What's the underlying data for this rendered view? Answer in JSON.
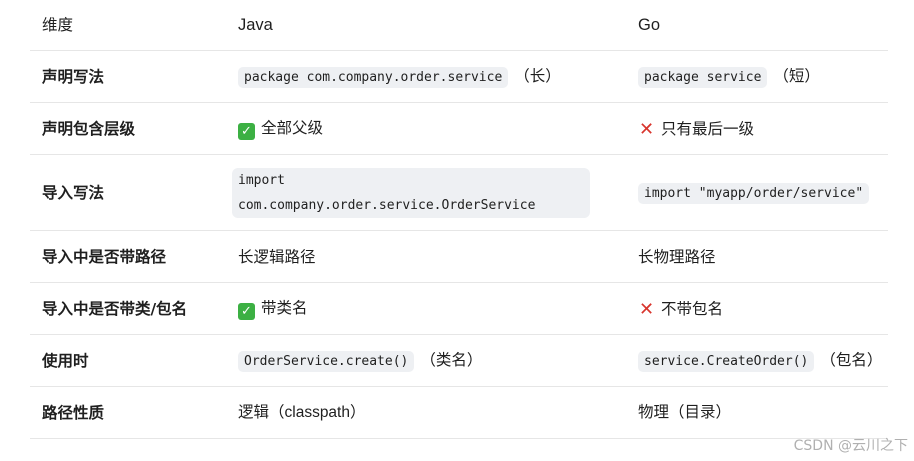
{
  "header": {
    "dim": "维度",
    "java": "Java",
    "go": "Go"
  },
  "rows": [
    {
      "label": "声明写法",
      "java": {
        "code": "package com.company.order.service",
        "note": "（长）"
      },
      "go": {
        "code": "package service",
        "note": "（短）"
      }
    },
    {
      "label": "声明包含层级",
      "java": {
        "icon": "check-mark-icon",
        "text": "全部父级"
      },
      "go": {
        "icon": "cross-mark-icon",
        "text": "只有最后一级"
      }
    },
    {
      "label": "导入写法",
      "java": {
        "code": "import com.company.order.service.OrderService"
      },
      "go": {
        "code": "import \"myapp/order/service\""
      }
    },
    {
      "label": "导入中是否带路径",
      "java": {
        "text": "长逻辑路径"
      },
      "go": {
        "text": "长物理路径"
      }
    },
    {
      "label": "导入中是否带类/包名",
      "java": {
        "icon": "check-mark-icon",
        "text": "带类名"
      },
      "go": {
        "icon": "cross-mark-icon",
        "text": "不带包名"
      }
    },
    {
      "label": "使用时",
      "java": {
        "code": "OrderService.create()",
        "note": "（类名）"
      },
      "go": {
        "code": "service.CreateOrder()",
        "note": "（包名）"
      }
    },
    {
      "label": "路径性质",
      "java": {
        "text": "逻辑（classpath）"
      },
      "go": {
        "text": "物理（目录）"
      }
    }
  ],
  "watermark": "CSDN @云川之下",
  "colors": {
    "check": "#3cb043",
    "cross": "#d8342c",
    "code_bg": "#eef0f3",
    "divider": "#e6e6e6"
  }
}
